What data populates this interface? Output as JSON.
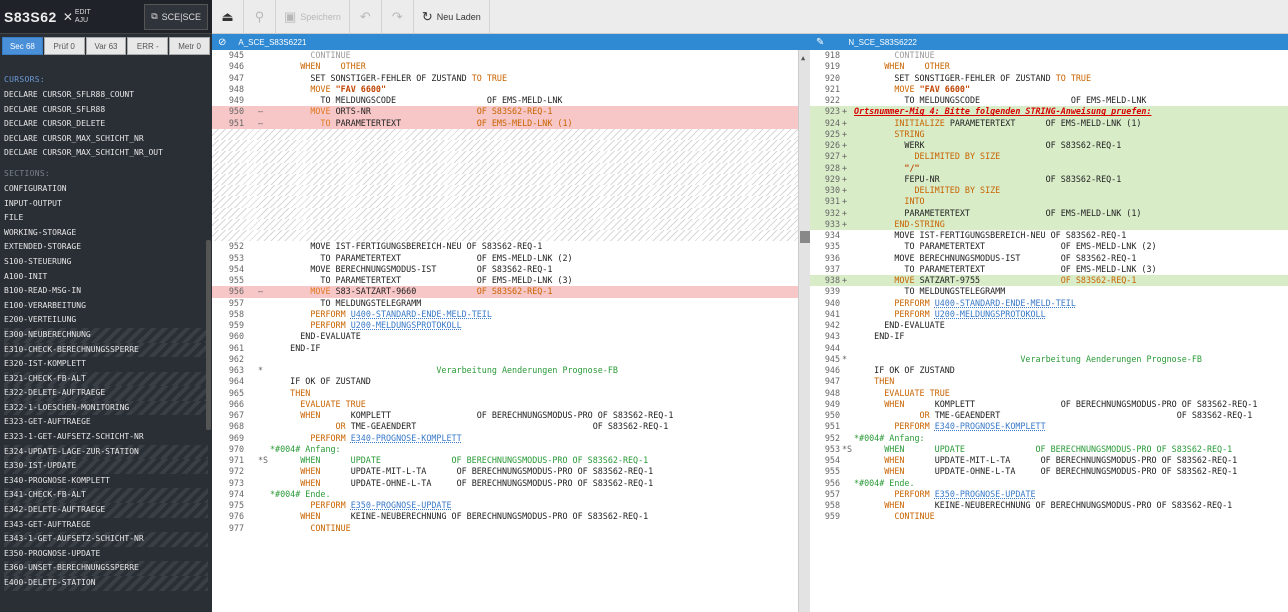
{
  "sidebar": {
    "title": "S83S62",
    "mode_edit": "EDIT",
    "mode_aju": "AJU",
    "scsce_label": "SCE|SCE",
    "filters": [
      {
        "label": "Sec 68",
        "active": true
      },
      {
        "label": "Prüf 0",
        "active": false
      },
      {
        "label": "Var 63",
        "active": false
      },
      {
        "label": "ERR -",
        "active": false
      },
      {
        "label": "Metr 0",
        "active": false
      }
    ],
    "cursors_title": "CURSORS:",
    "cursors": [
      "DECLARE CURSOR_SFLR88_COUNT",
      "DECLARE CURSOR_SFLR88",
      "DECLARE CURSOR_DELETE",
      "DECLARE CURSOR_MAX_SCHICHT_NR",
      "DECLARE CURSOR_MAX_SCHICHT_NR_OUT"
    ],
    "sections_title": "SECTIONS:",
    "sections": [
      {
        "label": "CONFIGURATION",
        "h": false
      },
      {
        "label": "INPUT-OUTPUT",
        "h": false
      },
      {
        "label": "FILE",
        "h": false
      },
      {
        "label": "WORKING-STORAGE",
        "h": false
      },
      {
        "label": "EXTENDED-STORAGE",
        "h": false
      },
      {
        "label": "S100-STEUERUNG",
        "h": false
      },
      {
        "label": "A100-INIT",
        "h": false
      },
      {
        "label": "B100-READ-MSG-IN",
        "h": false
      },
      {
        "label": "E100-VERARBEITUNG",
        "h": false
      },
      {
        "label": "E200-VERTEILUNG",
        "h": false
      },
      {
        "label": "E300-NEUBERECHNUNG",
        "h": true
      },
      {
        "label": "E310-CHECK-BERECHNUNGSSPERRE",
        "h": true
      },
      {
        "label": "E320-IST-KOMPLETT",
        "h": false
      },
      {
        "label": "E321-CHECK-FB-ALT",
        "h": true
      },
      {
        "label": "E322-DELETE-AUFTRAEGE",
        "h": true
      },
      {
        "label": "E322-1-LOESCHEN-MONITORING",
        "h": true
      },
      {
        "label": "E323-GET-AUFTRAEGE",
        "h": false
      },
      {
        "label": "E323-1-GET-AUFSETZ-SCHICHT-NR",
        "h": false
      },
      {
        "label": "E324-UPDATE-LAGE-ZUR-STATION",
        "h": true
      },
      {
        "label": "E330-IST-UPDATE",
        "h": true
      },
      {
        "label": "E340-PROGNOSE-KOMPLETT",
        "h": false
      },
      {
        "label": "E341-CHECK-FB-ALT",
        "h": true
      },
      {
        "label": "E342-DELETE-AUFTRAEGE",
        "h": true
      },
      {
        "label": "E343-GET-AUFTRAEGE",
        "h": false
      },
      {
        "label": "E343-1-GET-AUFSETZ-SCHICHT-NR",
        "h": true
      },
      {
        "label": "E350-PROGNOSE-UPDATE",
        "h": false
      },
      {
        "label": "E360-UNSET-BERECHNUNGSSPERRE",
        "h": true
      },
      {
        "label": "E400-DELETE-STATION",
        "h": true
      }
    ]
  },
  "toolbar": {
    "save_label": "Speichern",
    "reload_label": "Neu Laden"
  },
  "left_pane": {
    "title": "A_SCE_S83S6221"
  },
  "right_pane": {
    "title": "N_SCE_S83S6222"
  },
  "left_lines": [
    {
      "n": "945",
      "m": "",
      "t": "plain",
      "c": [
        [
          "        CONTINUE",
          "pale"
        ]
      ]
    },
    {
      "n": "946",
      "m": "",
      "t": "plain",
      "c": [
        [
          "      WHEN    ",
          "kw"
        ],
        [
          "OTHER",
          "kw"
        ]
      ]
    },
    {
      "n": "947",
      "m": "",
      "t": "plain",
      "c": [
        [
          "        SET SONSTIGER-FEHLER ",
          ""
        ],
        [
          "OF",
          ""
        ],
        [
          " ZUSTAND ",
          ""
        ],
        [
          "TO TRUE",
          "kw"
        ]
      ]
    },
    {
      "n": "948",
      "m": "",
      "t": "plain",
      "c": [
        [
          "        MOVE ",
          "kw"
        ],
        [
          "\"FAV 6600\"",
          "str"
        ]
      ]
    },
    {
      "n": "949",
      "m": "",
      "t": "plain",
      "c": [
        [
          "          TO MELDUNGSCODE                  OF EMS-MELD-LNK",
          ""
        ]
      ]
    },
    {
      "n": "950",
      "m": "–",
      "t": "del",
      "c": [
        [
          "        MOVE ",
          "kw2"
        ],
        [
          "ORTS-NR                     ",
          ""
        ],
        [
          "OF S83S62-REQ-1",
          "kw"
        ]
      ]
    },
    {
      "n": "951",
      "m": "–",
      "t": "del",
      "c": [
        [
          "          TO ",
          "kw2"
        ],
        [
          "PARAMETERTEXT               ",
          ""
        ],
        [
          "OF EMS-MELD-LNK (1)",
          "kw"
        ]
      ]
    },
    {
      "n": "",
      "m": "",
      "t": "hatch",
      "c": []
    },
    {
      "n": "",
      "m": "",
      "t": "hatch",
      "c": []
    },
    {
      "n": "",
      "m": "",
      "t": "hatch",
      "c": []
    },
    {
      "n": "",
      "m": "",
      "t": "hatch",
      "c": []
    },
    {
      "n": "",
      "m": "",
      "t": "hatch",
      "c": []
    },
    {
      "n": "",
      "m": "",
      "t": "hatch",
      "c": []
    },
    {
      "n": "",
      "m": "",
      "t": "hatch",
      "c": []
    },
    {
      "n": "",
      "m": "",
      "t": "hatch",
      "c": []
    },
    {
      "n": "",
      "m": "",
      "t": "hatch",
      "c": []
    },
    {
      "n": "",
      "m": "",
      "t": "hatch",
      "c": []
    },
    {
      "n": "952",
      "m": "",
      "t": "plain",
      "c": [
        [
          "        MOVE IST-FERTIGUNGSBEREICH-NEU OF S83S62-REQ-1",
          ""
        ]
      ]
    },
    {
      "n": "953",
      "m": "",
      "t": "plain",
      "c": [
        [
          "          TO PARAMETERTEXT               OF EMS-MELD-LNK (2)",
          ""
        ]
      ]
    },
    {
      "n": "954",
      "m": "",
      "t": "plain",
      "c": [
        [
          "        MOVE BERECHNUNGSMODUS-IST        OF S83S62-REQ-1",
          ""
        ]
      ]
    },
    {
      "n": "955",
      "m": "",
      "t": "plain",
      "c": [
        [
          "          TO PARAMETERTEXT               OF EMS-MELD-LNK (3)",
          ""
        ]
      ]
    },
    {
      "n": "956",
      "m": "–",
      "t": "del",
      "c": [
        [
          "        MOVE ",
          "kw2"
        ],
        [
          "S83-SATZART-9660            ",
          ""
        ],
        [
          "OF S83S62-REQ-1",
          "kw"
        ]
      ]
    },
    {
      "n": "957",
      "m": "",
      "t": "plain",
      "c": [
        [
          "          TO MELDUNGSTELEGRAMM",
          ""
        ]
      ]
    },
    {
      "n": "958",
      "m": "",
      "t": "plain",
      "c": [
        [
          "        PERFORM ",
          "kw"
        ],
        [
          "U400-STANDARD-ENDE-MELD-TEIL",
          "lnk"
        ]
      ]
    },
    {
      "n": "959",
      "m": "",
      "t": "plain",
      "c": [
        [
          "        PERFORM ",
          "kw"
        ],
        [
          "U200-MELDUNGSPROTOKOLL",
          "lnk"
        ]
      ]
    },
    {
      "n": "960",
      "m": "",
      "t": "plain",
      "c": [
        [
          "      END-EVALUATE",
          ""
        ]
      ]
    },
    {
      "n": "961",
      "m": "",
      "t": "plain",
      "c": [
        [
          "    END-IF",
          ""
        ]
      ]
    },
    {
      "n": "962",
      "m": "",
      "t": "plain",
      "c": [
        [
          "",
          ""
        ]
      ]
    },
    {
      "n": "963",
      "m": "*",
      "t": "plain",
      "c": [
        [
          "                                 Verarbeitung Aenderungen Prognose-FB",
          "cmt"
        ]
      ]
    },
    {
      "n": "964",
      "m": "",
      "t": "plain",
      "c": [
        [
          "    IF OK OF ZUSTAND",
          ""
        ]
      ]
    },
    {
      "n": "965",
      "m": "",
      "t": "plain",
      "c": [
        [
          "    THEN",
          "kw"
        ]
      ]
    },
    {
      "n": "966",
      "m": "",
      "t": "plain",
      "c": [
        [
          "      EVALUATE TRUE",
          "kw"
        ]
      ]
    },
    {
      "n": "967",
      "m": "",
      "t": "plain",
      "c": [
        [
          "      WHEN      ",
          "kw"
        ],
        [
          "KOMPLETT                 OF BERECHNUNGSMODUS-PRO OF S83S62-REQ-1",
          ""
        ]
      ]
    },
    {
      "n": "968",
      "m": "",
      "t": "plain",
      "c": [
        [
          "             OR ",
          "kw"
        ],
        [
          "TME-GEAENDERT                                   OF S83S62-REQ-1",
          ""
        ]
      ]
    },
    {
      "n": "969",
      "m": "",
      "t": "plain",
      "c": [
        [
          "        PERFORM ",
          "kw"
        ],
        [
          "E340-PROGNOSE-KOMPLETT",
          "lnk"
        ]
      ]
    },
    {
      "n": "970",
      "m": "",
      "t": "plain",
      "c": [
        [
          "*#004# Anfang:",
          "cmt"
        ]
      ]
    },
    {
      "n": "971",
      "m": "*S",
      "t": "plain",
      "c": [
        [
          "      WHEN      UPDATE              OF BERECHNUNGSMODUS-PRO OF S83S62-REQ-1",
          "cmt"
        ]
      ]
    },
    {
      "n": "972",
      "m": "",
      "t": "plain",
      "c": [
        [
          "      WHEN      ",
          "kw"
        ],
        [
          "UPDATE-MIT-L-TA      OF BERECHNUNGSMODUS-PRO OF S83S62-REQ-1",
          ""
        ]
      ]
    },
    {
      "n": "973",
      "m": "",
      "t": "plain",
      "c": [
        [
          "      WHEN      ",
          "kw"
        ],
        [
          "UPDATE-OHNE-L-TA     OF BERECHNUNGSMODUS-PRO OF S83S62-REQ-1",
          ""
        ]
      ]
    },
    {
      "n": "974",
      "m": "",
      "t": "plain",
      "c": [
        [
          "*#004# Ende.",
          "cmt"
        ]
      ]
    },
    {
      "n": "975",
      "m": "",
      "t": "plain",
      "c": [
        [
          "        PERFORM ",
          "kw"
        ],
        [
          "E350-PROGNOSE-UPDATE",
          "lnk"
        ]
      ]
    },
    {
      "n": "976",
      "m": "",
      "t": "plain",
      "c": [
        [
          "      WHEN      ",
          "kw"
        ],
        [
          "KEINE-NEUBERECHNUNG OF BERECHNUNGSMODUS-PRO OF S83S62-REQ-1",
          ""
        ]
      ]
    },
    {
      "n": "977",
      "m": "",
      "t": "plain",
      "c": [
        [
          "        CONTINUE",
          "kw"
        ]
      ]
    }
  ],
  "right_lines": [
    {
      "n": "918",
      "m": "",
      "t": "plain",
      "c": [
        [
          "        CONTINUE",
          "pale"
        ]
      ]
    },
    {
      "n": "919",
      "m": "",
      "t": "plain",
      "c": [
        [
          "      WHEN    ",
          "kw"
        ],
        [
          "OTHER",
          "kw"
        ]
      ]
    },
    {
      "n": "920",
      "m": "",
      "t": "plain",
      "c": [
        [
          "        SET SONSTIGER-FEHLER OF ZUSTAND ",
          ""
        ],
        [
          "TO TRUE",
          "kw"
        ]
      ]
    },
    {
      "n": "921",
      "m": "",
      "t": "plain",
      "c": [
        [
          "        MOVE ",
          "kw"
        ],
        [
          "\"FAV 6600\"",
          "str"
        ]
      ]
    },
    {
      "n": "922",
      "m": "",
      "t": "plain",
      "c": [
        [
          "          TO MELDUNGSCODE                  OF EMS-MELD-LNK",
          ""
        ]
      ]
    },
    {
      "n": "923",
      "m": "+",
      "t": "add",
      "c": [
        [
          "Ortsnummer-Mig 4: Bitte folgenden STRING-Anweisung pruefen:",
          "ann"
        ]
      ]
    },
    {
      "n": "924",
      "m": "+",
      "t": "add",
      "c": [
        [
          "        INITIALIZE ",
          "kw"
        ],
        [
          "PARAMETERTEXT      OF EMS-MELD-LNK (1)",
          ""
        ]
      ]
    },
    {
      "n": "925",
      "m": "+",
      "t": "add",
      "c": [
        [
          "        STRING",
          "kw"
        ]
      ]
    },
    {
      "n": "926",
      "m": "+",
      "t": "add",
      "c": [
        [
          "          WERK                        OF S83S62-REQ-1",
          ""
        ]
      ]
    },
    {
      "n": "927",
      "m": "+",
      "t": "add",
      "c": [
        [
          "            DELIMITED BY SIZE",
          "kw"
        ]
      ]
    },
    {
      "n": "928",
      "m": "+",
      "t": "add",
      "c": [
        [
          "          \"/\"",
          "str"
        ]
      ]
    },
    {
      "n": "929",
      "m": "+",
      "t": "add",
      "c": [
        [
          "          FEPU-NR                     OF S83S62-REQ-1",
          ""
        ]
      ]
    },
    {
      "n": "930",
      "m": "+",
      "t": "add",
      "c": [
        [
          "            DELIMITED BY SIZE",
          "kw"
        ]
      ]
    },
    {
      "n": "931",
      "m": "+",
      "t": "add",
      "c": [
        [
          "          INTO",
          "kw"
        ]
      ]
    },
    {
      "n": "932",
      "m": "+",
      "t": "add",
      "c": [
        [
          "          PARAMETERTEXT               OF EMS-MELD-LNK (1)",
          ""
        ]
      ]
    },
    {
      "n": "933",
      "m": "+",
      "t": "add",
      "c": [
        [
          "        END-STRING",
          "kw"
        ]
      ]
    },
    {
      "n": "934",
      "m": "",
      "t": "plain",
      "c": [
        [
          "        MOVE IST-FERTIGUNGSBEREICH-NEU OF S83S62-REQ-1",
          ""
        ]
      ]
    },
    {
      "n": "935",
      "m": "",
      "t": "plain",
      "c": [
        [
          "          TO PARAMETERTEXT               OF EMS-MELD-LNK (2)",
          ""
        ]
      ]
    },
    {
      "n": "936",
      "m": "",
      "t": "plain",
      "c": [
        [
          "        MOVE BERECHNUNGSMODUS-IST        OF S83S62-REQ-1",
          ""
        ]
      ]
    },
    {
      "n": "937",
      "m": "",
      "t": "plain",
      "c": [
        [
          "          TO PARAMETERTEXT               OF EMS-MELD-LNK (3)",
          ""
        ]
      ]
    },
    {
      "n": "938",
      "m": "+",
      "t": "add",
      "c": [
        [
          "        MOVE ",
          "kw"
        ],
        [
          "SATZART-9755                ",
          ""
        ],
        [
          "OF S83S62-REQ-1",
          "kw"
        ]
      ]
    },
    {
      "n": "939",
      "m": "",
      "t": "plain",
      "c": [
        [
          "          TO MELDUNGSTELEGRAMM",
          ""
        ]
      ]
    },
    {
      "n": "940",
      "m": "",
      "t": "plain",
      "c": [
        [
          "        PERFORM ",
          "kw"
        ],
        [
          "U400-STANDARD-ENDE-MELD-TEIL",
          "lnk"
        ]
      ]
    },
    {
      "n": "941",
      "m": "",
      "t": "plain",
      "c": [
        [
          "        PERFORM ",
          "kw"
        ],
        [
          "U200-MELDUNGSPROTOKOLL",
          "lnk"
        ]
      ]
    },
    {
      "n": "942",
      "m": "",
      "t": "plain",
      "c": [
        [
          "      END-EVALUATE",
          ""
        ]
      ]
    },
    {
      "n": "943",
      "m": "",
      "t": "plain",
      "c": [
        [
          "    END-IF",
          ""
        ]
      ]
    },
    {
      "n": "944",
      "m": "",
      "t": "plain",
      "c": [
        [
          "",
          ""
        ]
      ]
    },
    {
      "n": "945",
      "m": "*",
      "t": "plain",
      "c": [
        [
          "                                 Verarbeitung Aenderungen Prognose-FB",
          "cmt"
        ]
      ]
    },
    {
      "n": "946",
      "m": "",
      "t": "plain",
      "c": [
        [
          "    IF OK OF ZUSTAND",
          ""
        ]
      ]
    },
    {
      "n": "947",
      "m": "",
      "t": "plain",
      "c": [
        [
          "    THEN",
          "kw"
        ]
      ]
    },
    {
      "n": "948",
      "m": "",
      "t": "plain",
      "c": [
        [
          "      EVALUATE TRUE",
          "kw"
        ]
      ]
    },
    {
      "n": "949",
      "m": "",
      "t": "plain",
      "c": [
        [
          "      WHEN      ",
          "kw"
        ],
        [
          "KOMPLETT                 OF BERECHNUNGSMODUS-PRO OF S83S62-REQ-1",
          ""
        ]
      ]
    },
    {
      "n": "950",
      "m": "",
      "t": "plain",
      "c": [
        [
          "             OR ",
          "kw"
        ],
        [
          "TME-GEAENDERT                                   OF S83S62-REQ-1",
          ""
        ]
      ]
    },
    {
      "n": "951",
      "m": "",
      "t": "plain",
      "c": [
        [
          "        PERFORM ",
          "kw"
        ],
        [
          "E340-PROGNOSE-KOMPLETT",
          "lnk"
        ]
      ]
    },
    {
      "n": "952",
      "m": "",
      "t": "plain",
      "c": [
        [
          "*#004# Anfang:",
          "cmt"
        ]
      ]
    },
    {
      "n": "953",
      "m": "*S",
      "t": "plain",
      "c": [
        [
          "      WHEN      UPDATE              OF BERECHNUNGSMODUS-PRO OF S83S62-REQ-1",
          "cmt"
        ]
      ]
    },
    {
      "n": "954",
      "m": "",
      "t": "plain",
      "c": [
        [
          "      WHEN      ",
          "kw"
        ],
        [
          "UPDATE-MIT-L-TA      OF BERECHNUNGSMODUS-PRO OF S83S62-REQ-1",
          ""
        ]
      ]
    },
    {
      "n": "955",
      "m": "",
      "t": "plain",
      "c": [
        [
          "      WHEN      ",
          "kw"
        ],
        [
          "UPDATE-OHNE-L-TA     OF BERECHNUNGSMODUS-PRO OF S83S62-REQ-1",
          ""
        ]
      ]
    },
    {
      "n": "956",
      "m": "",
      "t": "plain",
      "c": [
        [
          "*#004# Ende.",
          "cmt"
        ]
      ]
    },
    {
      "n": "957",
      "m": "",
      "t": "plain",
      "c": [
        [
          "        PERFORM ",
          "kw"
        ],
        [
          "E350-PROGNOSE-UPDATE",
          "lnk"
        ]
      ]
    },
    {
      "n": "958",
      "m": "",
      "t": "plain",
      "c": [
        [
          "      WHEN      ",
          "kw"
        ],
        [
          "KEINE-NEUBERECHNUNG OF BERECHNUNGSMODUS-PRO OF S83S62-REQ-1",
          ""
        ]
      ]
    },
    {
      "n": "959",
      "m": "",
      "t": "plain",
      "c": [
        [
          "        CONTINUE",
          "kw"
        ]
      ]
    }
  ]
}
